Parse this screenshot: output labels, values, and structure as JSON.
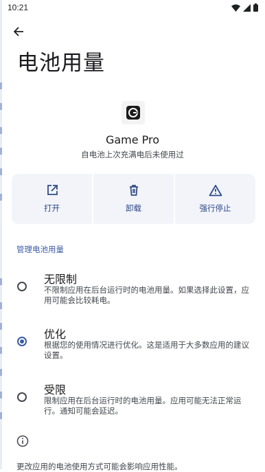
{
  "status": {
    "time": "10:21"
  },
  "page": {
    "title": "电池用量"
  },
  "app": {
    "name": "Game Pro",
    "subtitle": "自电池上次充满电后未使用过"
  },
  "actions": [
    {
      "label": "打开",
      "icon": "open-in-new-icon"
    },
    {
      "label": "卸载",
      "icon": "trash-icon"
    },
    {
      "label": "强行停止",
      "icon": "warning-icon"
    }
  ],
  "section": {
    "title": "管理电池用量"
  },
  "options": [
    {
      "title": "无限制",
      "desc": "不限制应用在后台运行时的电池用量。如果选择此设置，应用可能会比较耗电。",
      "selected": false
    },
    {
      "title": "优化",
      "desc": "根据您的使用情况进行优化。这是适用于大多数应用的建议设置。",
      "selected": true
    },
    {
      "title": "受限",
      "desc": "限制应用在后台运行时的电池用量。应用可能无法正常运行。通知可能会延迟。",
      "selected": false
    }
  ],
  "footer": {
    "text": "更改应用的电池使用方式可能会影响应用性能。"
  },
  "colors": {
    "accent": "#3a5aa5",
    "surface": "#f2f4fa"
  }
}
